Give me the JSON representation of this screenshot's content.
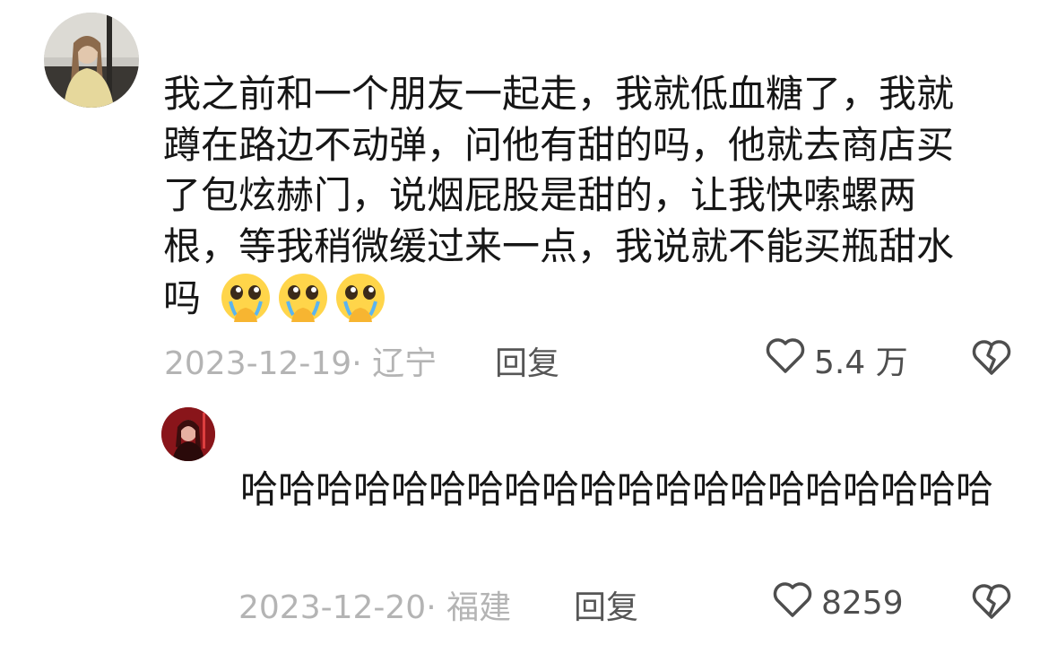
{
  "comments": [
    {
      "text": "我之前和一个朋友一起走，我就低血糖了，我就蹲在路边不动弹，问他有甜的吗，他就去商店买了包炫赫门，说烟屁股是甜的，让我快嗦螺两根，等我稍微缓过来一点，我说就不能买瓶甜水吗",
      "emoji_icon": "pleading-face-emoji",
      "emoji_count": 3,
      "date": "2023-12-19",
      "location": "辽宁",
      "date_location": "2023-12-19· 辽宁",
      "reply_label": "回复",
      "likes": "5.4 万"
    },
    {
      "text": "哈哈哈哈哈哈哈哈哈哈哈哈哈哈哈哈哈哈哈哈",
      "date_location": "2023-12-20· 福建",
      "reply_label": "回复",
      "likes": "8259"
    }
  ],
  "icons": {
    "like": "heart-outline-icon",
    "dislike": "broken-heart-icon"
  },
  "colors": {
    "text": "#161616",
    "meta": "#b4b4b4",
    "icon": "#4e4e4e"
  }
}
